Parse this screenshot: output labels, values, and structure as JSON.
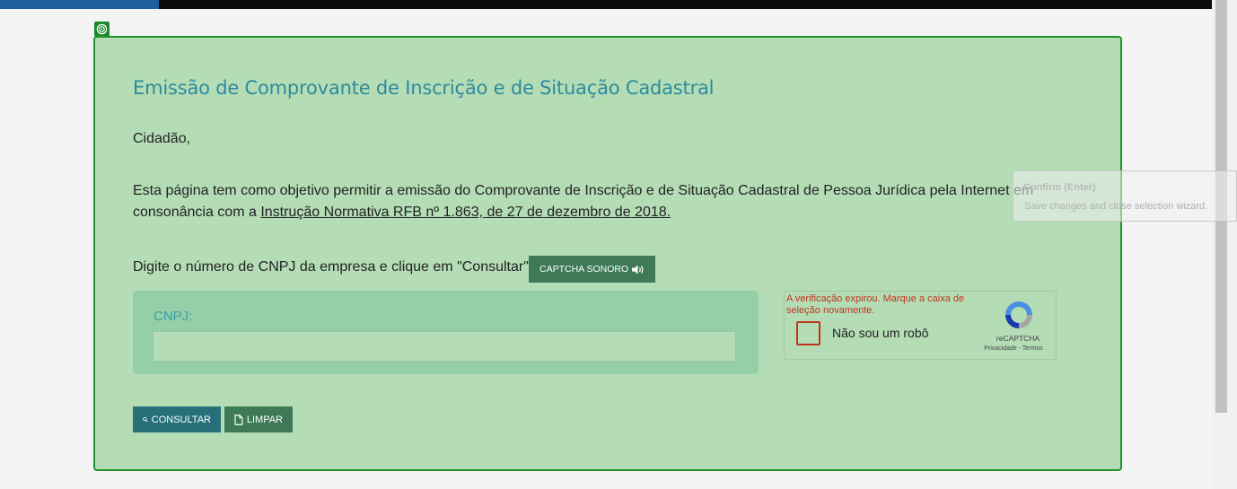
{
  "page": {
    "title": "Emissão de Comprovante de Inscrição e de Situação Cadastral",
    "greeting": "Cidadão,",
    "description_before": "Esta página tem como objetivo permitir a emissão do Comprovante de Inscrição e de Situação Cadastral de Pessoa Jurídica pela Internet em consonância com a ",
    "description_link": "Instrução Normativa RFB nº 1.863, de 27 de dezembro de 2018.",
    "instruction": "Digite o número de CNPJ da empresa e clique em \"Consultar\".",
    "audio_captcha_label": "CAPTCHA SONORO"
  },
  "form": {
    "cnpj_label": "CNPJ:",
    "cnpj_value": "",
    "cnpj_placeholder": ""
  },
  "recaptcha": {
    "error": "A verificação expirou. Marque a caixa de seleção novamente.",
    "checkbox_label": "Não sou um robô",
    "brand": "reCAPTCHA",
    "links": "Privacidade - Termos"
  },
  "buttons": {
    "search_label": "CONSULTAR",
    "clear_label": "LIMPAR"
  },
  "tooltip": {
    "title": "Confirm (Enter)",
    "text": "Save changes and close selection wizard."
  },
  "colors": {
    "panel_bg": "#b4ddb6",
    "panel_border": "#23912d",
    "title": "#2f8a9b",
    "error": "#c2331c",
    "search_button": "#27707a",
    "secondary_button": "#3d7a55"
  },
  "icons": [
    "target-icon",
    "speaker-icon",
    "search-icon",
    "document-icon",
    "recaptcha-logo-icon"
  ]
}
